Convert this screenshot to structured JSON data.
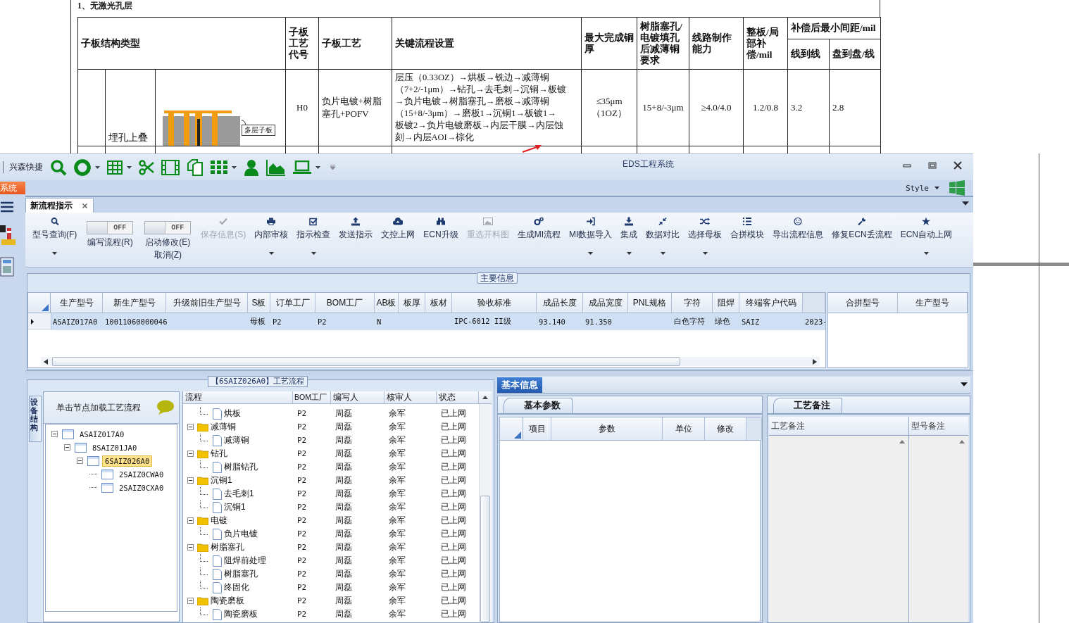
{
  "document": {
    "heading": "1、无激光孔层",
    "header": {
      "structure_type": "子板结构类型",
      "code": "子板工艺代号",
      "process": "子板工艺",
      "key_flow": "关键流程设置",
      "max_copper": "最大完成铜厚",
      "thinning": "树脂塞孔/电镀填孔后减薄铜要求",
      "line_capability": "线路制作能力",
      "compensation": "整板/局部补偿/mil",
      "min_spacing": "补偿后最小间距/mil",
      "line_to_line": "线到线",
      "pad_to_pad": "盘到盘/线"
    },
    "rows": [
      {
        "structure": "埋孔上叠",
        "figure_label": "多层子板",
        "code": "H0",
        "process": "负片电镀+树脂塞孔+POFV",
        "key_flow": [
          "层压（0.33OZ）→烘板→铣边→减薄铜",
          "（7+2/-1μm）→钻孔→去毛刺→沉铜→板镀",
          "→负片电镀→树脂塞孔→磨板→减薄铜",
          "（15+8/-3μm）→磨板1→沉铜1→板镀1→",
          "板镀2→负片电镀磨板→内层干膜→内层蚀",
          "刻→内层AOI→棕化"
        ],
        "max_copper": "≤35μm（1OZ）",
        "thinning": "15+8/-3μm",
        "line_capability": "≥4.0/4.0",
        "compensation": "1.2/0.8",
        "line_to_line": "3.2",
        "pad_to_pad": "2.8"
      }
    ]
  },
  "window": {
    "title": "EDS工程系统",
    "quick_access_label": "兴森快捷",
    "system_tab": "系统",
    "style_menu": "Style"
  },
  "tabs": [
    {
      "label": "新流程指示",
      "selected": true
    }
  ],
  "ribbon": [
    {
      "kind": "button",
      "label": "型号查询(F)",
      "disabled": false,
      "dropdown": true
    },
    {
      "kind": "toggle",
      "label": "编写流程(R)",
      "state_text": "OFF",
      "on": false
    },
    {
      "kind": "toggle",
      "label": "启动修改(E)",
      "label_2": "取消(Z)",
      "state_text": "OFF",
      "on": false
    },
    {
      "kind": "button",
      "label": "保存信息(S)",
      "disabled": true,
      "dropdown": false
    },
    {
      "kind": "button",
      "label": "内部审核",
      "disabled": false,
      "dropdown": true
    },
    {
      "kind": "button",
      "label": "指示检查",
      "disabled": false,
      "dropdown": true
    },
    {
      "kind": "button",
      "label": "发送指示",
      "disabled": false,
      "dropdown": false
    },
    {
      "kind": "button",
      "label": "文控上网",
      "disabled": false,
      "dropdown": false
    },
    {
      "kind": "button",
      "label": "ECN升级",
      "disabled": false,
      "dropdown": false
    },
    {
      "kind": "button",
      "label": "重选开料图",
      "disabled": true,
      "dropdown": false
    },
    {
      "kind": "button",
      "label": "生成MI流程",
      "disabled": false,
      "dropdown": false
    },
    {
      "kind": "button",
      "label": "MI数据导入",
      "disabled": false,
      "dropdown": true
    },
    {
      "kind": "button",
      "label": "集成",
      "disabled": false,
      "dropdown": true
    },
    {
      "kind": "button",
      "label": "数据对比",
      "disabled": false,
      "dropdown": true
    },
    {
      "kind": "button",
      "label": "选择母板",
      "disabled": false,
      "dropdown": true
    },
    {
      "kind": "button",
      "label": "合拼模块",
      "disabled": false,
      "dropdown": false
    },
    {
      "kind": "button",
      "label": "导出流程信息",
      "disabled": false,
      "dropdown": false
    },
    {
      "kind": "button",
      "label": "修复ECN丢流程",
      "disabled": false,
      "dropdown": false
    },
    {
      "kind": "button",
      "label": "ECN自动上网",
      "disabled": false,
      "dropdown": true
    }
  ],
  "main_info": {
    "title": "主要信息",
    "columns": [
      "生产型号",
      "新生产型号",
      "升级前旧生产型号",
      "S板",
      "订单工厂",
      "BOM工厂",
      "AB板",
      "板厚",
      "板材",
      "验收标准",
      "成品长度",
      "成品宽度",
      "PNL规格",
      "字符",
      "阻焊",
      "终端客户代码"
    ],
    "rows": [
      {
        "selected": true,
        "cells": [
          "ASAIZ017A0",
          "10011060000046",
          "",
          "母板",
          "P2",
          "P2",
          "N",
          "",
          "",
          "IPC-6012 II级",
          "93.140",
          "91.350",
          "",
          "白色字符",
          "绿色",
          "SAIZ",
          "2023-"
        ]
      }
    ],
    "side_columns": [
      "合拼型号",
      "生产型号"
    ]
  },
  "process_flow": {
    "title": "【6SAIZ026A0】工艺流程",
    "side_tab": "设备结构",
    "hint": "单击节点加载工艺流程",
    "structure": [
      {
        "label": "ASAIZ017A0",
        "selected": false,
        "expanded": true,
        "children": [
          {
            "label": "8SAIZ01JA0",
            "selected": false,
            "expanded": true,
            "children": [
              {
                "label": "6SAIZ026A0",
                "selected": true,
                "expanded": true,
                "children": [
                  {
                    "label": "2SAIZ0CWA0",
                    "selected": false
                  },
                  {
                    "label": "2SAIZ0CXA0",
                    "selected": false
                  }
                ]
              }
            ]
          }
        ]
      }
    ],
    "columns": [
      "流程",
      "BOM工厂",
      "编写人",
      "核审人",
      "状态"
    ],
    "steps": [
      {
        "kind": "step",
        "name": "烘板",
        "bom": "P2",
        "writer": "周磊",
        "reviewer": "余军",
        "status": "已上网"
      },
      {
        "kind": "folder",
        "name": "减薄铜",
        "bom": "P2",
        "writer": "周磊",
        "reviewer": "余军",
        "status": "已上网",
        "expanded": true,
        "children": [
          {
            "kind": "step",
            "name": "减薄铜",
            "bom": "P2",
            "writer": "周磊",
            "reviewer": "余军",
            "status": "已上网"
          }
        ]
      },
      {
        "kind": "folder",
        "name": "钻孔",
        "bom": "P2",
        "writer": "周磊",
        "reviewer": "余军",
        "status": "已上网",
        "expanded": true,
        "children": [
          {
            "kind": "step",
            "name": "树脂钻孔",
            "bom": "P2",
            "writer": "周磊",
            "reviewer": "余军",
            "status": "已上网"
          }
        ]
      },
      {
        "kind": "folder",
        "name": "沉铜1",
        "bom": "P2",
        "writer": "周磊",
        "reviewer": "余军",
        "status": "已上网",
        "expanded": true,
        "children": [
          {
            "kind": "step",
            "name": "去毛刺1",
            "bom": "P2",
            "writer": "周磊",
            "reviewer": "余军",
            "status": "已上网"
          },
          {
            "kind": "step",
            "name": "沉铜1",
            "bom": "P2",
            "writer": "周磊",
            "reviewer": "余军",
            "status": "已上网"
          }
        ]
      },
      {
        "kind": "folder",
        "name": "电镀",
        "bom": "P2",
        "writer": "周磊",
        "reviewer": "余军",
        "status": "已上网",
        "expanded": true,
        "children": [
          {
            "kind": "step",
            "name": "负片电镀",
            "bom": "P2",
            "writer": "周磊",
            "reviewer": "余军",
            "status": "已上网"
          }
        ]
      },
      {
        "kind": "folder",
        "name": "树脂塞孔",
        "bom": "P2",
        "writer": "周磊",
        "reviewer": "余军",
        "status": "已上网",
        "expanded": true,
        "children": [
          {
            "kind": "step",
            "name": "阻焊前处理",
            "bom": "P2",
            "writer": "周磊",
            "reviewer": "余军",
            "status": "已上网"
          },
          {
            "kind": "step",
            "name": "树脂塞孔",
            "bom": "P2",
            "writer": "周磊",
            "reviewer": "余军",
            "status": "已上网"
          },
          {
            "kind": "step",
            "name": "终固化",
            "bom": "P2",
            "writer": "周磊",
            "reviewer": "余军",
            "status": "已上网"
          }
        ]
      },
      {
        "kind": "folder",
        "name": "陶瓷磨板",
        "bom": "P2",
        "writer": "周磊",
        "reviewer": "余军",
        "status": "已上网",
        "expanded": true,
        "children": [
          {
            "kind": "step",
            "name": "陶瓷磨板",
            "bom": "P2",
            "writer": "周磊",
            "reviewer": "余军",
            "status": "已上网"
          }
        ]
      }
    ]
  },
  "details": {
    "tabs": [
      {
        "label": "基本信息",
        "selected": true
      }
    ],
    "params": {
      "tab": "基本参数",
      "columns": [
        "项目",
        "参数",
        "单位",
        "修改"
      ]
    },
    "notes": {
      "tab": "工艺备注",
      "columns": [
        "工艺备注",
        "型号备注"
      ]
    }
  }
}
